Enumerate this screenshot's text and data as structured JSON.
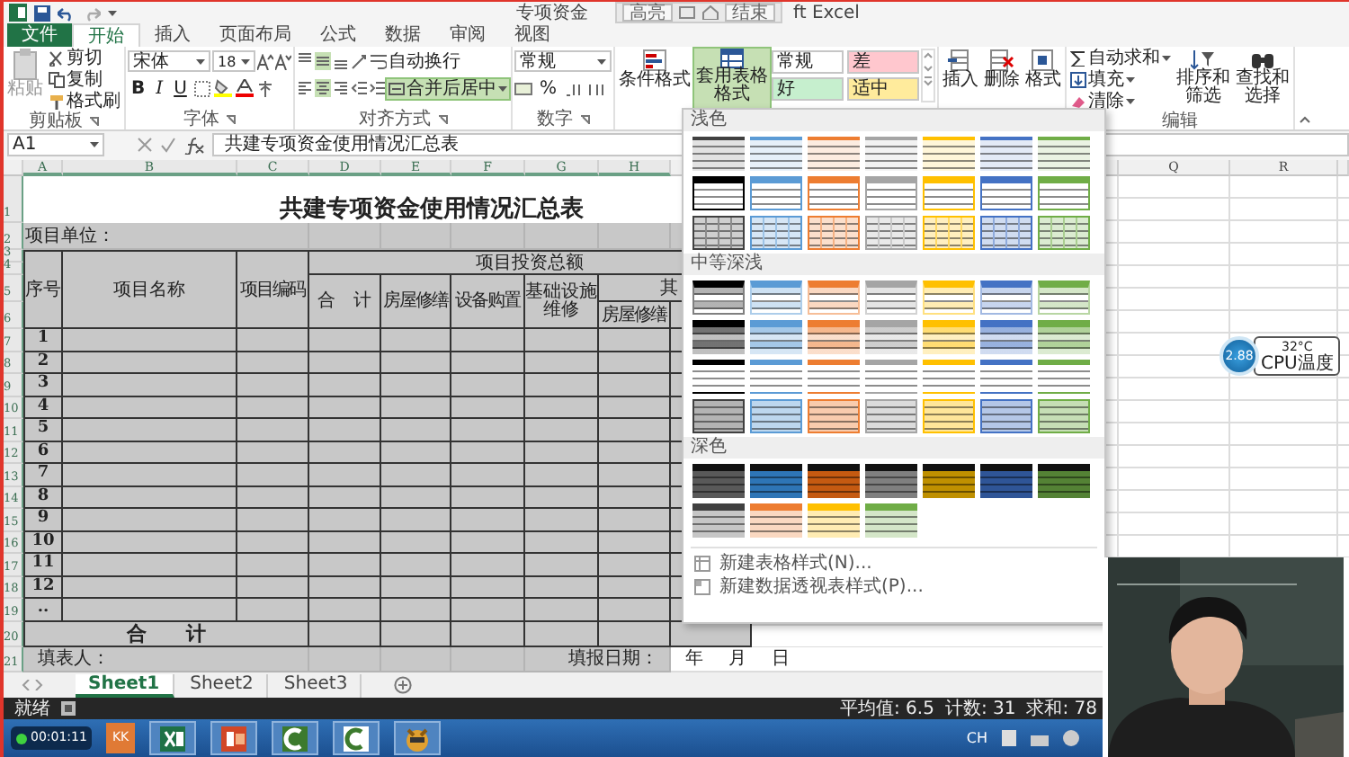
{
  "window": {
    "title": "专项资金",
    "title_tail": "ft Excel"
  },
  "recorder_toolbar": {
    "highlight": "高亮",
    "stop": "结束"
  },
  "ribbon_tabs": [
    {
      "label": "文件",
      "kind": "file",
      "selected": false
    },
    {
      "label": "开始",
      "kind": "tab",
      "selected": true
    },
    {
      "label": "插入",
      "kind": "tab",
      "selected": false
    },
    {
      "label": "页面布局",
      "kind": "tab",
      "selected": false
    },
    {
      "label": "公式",
      "kind": "tab",
      "selected": false
    },
    {
      "label": "数据",
      "kind": "tab",
      "selected": false
    },
    {
      "label": "审阅",
      "kind": "tab",
      "selected": false
    },
    {
      "label": "视图",
      "kind": "tab",
      "selected": false
    }
  ],
  "ribbon": {
    "clipboard": {
      "label": "剪贴板",
      "paste": "粘贴",
      "cut": "剪切",
      "copy": "复制",
      "format_painter": "格式刷"
    },
    "font": {
      "label": "字体",
      "family": "宋体",
      "size": "18",
      "bold": "B",
      "italic": "I",
      "underline": "U"
    },
    "alignment": {
      "label": "对齐方式",
      "wrap": "自动换行",
      "merge": "合并后居中",
      "merge_on": true,
      "middle_on": true,
      "center_on": true
    },
    "number": {
      "label": "数字",
      "format": "常规",
      "percent": "%"
    },
    "styles": {
      "conditional": "条件格式",
      "table_format": "套用表格格式",
      "table_format_open": true,
      "cell_styles": [
        {
          "label": "常规",
          "color": "#ffffff"
        },
        {
          "label": "差",
          "color": "#ffc7ce"
        },
        {
          "label": "好",
          "color": "#c6efce"
        },
        {
          "label": "适中",
          "color": "#ffeb9c"
        }
      ]
    },
    "cells": {
      "buttons": [
        "插入",
        "删除",
        "格式"
      ]
    },
    "editing": {
      "label": "编辑",
      "autosum": "自动求和",
      "fill": "填充",
      "clear": "清除",
      "sort": "排序和筛选",
      "find": "查找和选择"
    }
  },
  "formula_bar": {
    "name_box": "A1",
    "content": "共建专项资金使用情况汇总表"
  },
  "sheet": {
    "columns": [
      "A",
      "B",
      "C",
      "D",
      "E",
      "F",
      "G",
      "H"
    ],
    "far_columns": [
      "Q",
      "R"
    ],
    "row_numbers": [
      "1",
      "2",
      "3",
      "4",
      "5",
      "6",
      "7",
      "8",
      "9",
      "10",
      "11",
      "12",
      "13",
      "14",
      "15",
      "16",
      "17",
      "18",
      "19",
      "20",
      "21"
    ],
    "title": "共建专项资金使用情况汇总表",
    "unit_label": "项目单位：",
    "headers": {
      "no": "序号",
      "name": "项目名称",
      "code": "项目编码",
      "total_invest": "项目投资总额",
      "sum": "合　计",
      "housing": "房屋修缮",
      "equipment": "设备购置",
      "infrastructure": "基础设施维修",
      "other": "其",
      "other_housing": "房屋修缮"
    },
    "item_numbers": [
      "1",
      "2",
      "3",
      "4",
      "5",
      "6",
      "7",
      "8",
      "9",
      "10",
      "11",
      "12",
      ".."
    ],
    "total_label": "合　　计",
    "filled_by": "填表人：",
    "report_date": "填报日期：",
    "year": "年",
    "month": "月",
    "day": "日"
  },
  "gallery": {
    "sections": [
      {
        "title": "浅色",
        "rows": [
          {
            "kind": "lines",
            "swatches": [
              {
                "color": "#404040"
              },
              {
                "color": "#5b9bd5"
              },
              {
                "color": "#ed7d31"
              },
              {
                "color": "#a5a5a5"
              },
              {
                "color": "#ffc000"
              },
              {
                "color": "#4472c4"
              },
              {
                "color": "#70ad47"
              }
            ]
          },
          {
            "kind": "header-outline",
            "swatches": [
              {
                "color": "#000000"
              },
              {
                "color": "#5b9bd5"
              },
              {
                "color": "#ed7d31"
              },
              {
                "color": "#a5a5a5"
              },
              {
                "color": "#ffc000"
              },
              {
                "color": "#4472c4"
              },
              {
                "color": "#70ad47"
              }
            ]
          },
          {
            "kind": "grid-light",
            "swatches": [
              {
                "color": "#404040"
              },
              {
                "color": "#5b9bd5"
              },
              {
                "color": "#ed7d31"
              },
              {
                "color": "#a5a5a5"
              },
              {
                "color": "#ffc000"
              },
              {
                "color": "#4472c4"
              },
              {
                "color": "#70ad47"
              }
            ]
          }
        ]
      },
      {
        "title": "中等深浅",
        "rows": [
          {
            "kind": "header-banded",
            "swatches": [
              {
                "color": "#000000"
              },
              {
                "color": "#5b9bd5"
              },
              {
                "color": "#ed7d31"
              },
              {
                "color": "#a5a5a5"
              },
              {
                "color": "#ffc000"
              },
              {
                "color": "#4472c4"
              },
              {
                "color": "#70ad47"
              }
            ]
          },
          {
            "kind": "banded-strong",
            "swatches": [
              {
                "color": "#000000"
              },
              {
                "color": "#5b9bd5"
              },
              {
                "color": "#ed7d31"
              },
              {
                "color": "#a5a5a5"
              },
              {
                "color": "#ffc000"
              },
              {
                "color": "#4472c4"
              },
              {
                "color": "#70ad47"
              }
            ]
          },
          {
            "kind": "header-lines",
            "swatches": [
              {
                "color": "#000000"
              },
              {
                "color": "#5b9bd5"
              },
              {
                "color": "#ed7d31"
              },
              {
                "color": "#a5a5a5"
              },
              {
                "color": "#ffc000"
              },
              {
                "color": "#4472c4"
              },
              {
                "color": "#70ad47"
              }
            ]
          },
          {
            "kind": "banded-full",
            "swatches": [
              {
                "color": "#404040"
              },
              {
                "color": "#5b9bd5"
              },
              {
                "color": "#ed7d31"
              },
              {
                "color": "#a5a5a5"
              },
              {
                "color": "#ffc000"
              },
              {
                "color": "#4472c4"
              },
              {
                "color": "#70ad47"
              }
            ]
          }
        ]
      },
      {
        "title": "深色",
        "rows": [
          {
            "kind": "dark",
            "swatches": [
              {
                "color": "#595959"
              },
              {
                "color": "#2e75b6"
              },
              {
                "color": "#c55a11"
              },
              {
                "color": "#7f7f7f"
              },
              {
                "color": "#bf9000"
              },
              {
                "color": "#2f5597"
              },
              {
                "color": "#548235"
              }
            ]
          },
          {
            "kind": "dark-alt",
            "swatches": [
              {
                "color": "#404040"
              },
              {
                "color": "#ed7d31"
              },
              {
                "color": "#ffc000"
              },
              {
                "color": "#70ad47"
              }
            ]
          }
        ]
      }
    ],
    "commands": [
      "新建表格样式(N)...",
      "新建数据透视表样式(P)..."
    ]
  },
  "sheet_tabs": [
    {
      "label": "Sheet1",
      "selected": true
    },
    {
      "label": "Sheet2",
      "selected": false
    },
    {
      "label": "Sheet3",
      "selected": false
    }
  ],
  "status_bar": {
    "state": "就绪",
    "average": "平均值: 6.5",
    "count": "计数: 31",
    "sum": "求和: 78"
  },
  "cpu_widget": {
    "usage": "2.88",
    "temperature": "32°C",
    "label": "CPU温度"
  },
  "taskbar": {
    "clock": "00:01:11",
    "kk_label": "KK",
    "apps": [
      {
        "kind": "spreadsheet"
      },
      {
        "kind": "slides"
      },
      {
        "kind": "recorder"
      },
      {
        "kind": "recorder-light"
      },
      {
        "kind": "game"
      }
    ],
    "language": "CH"
  }
}
